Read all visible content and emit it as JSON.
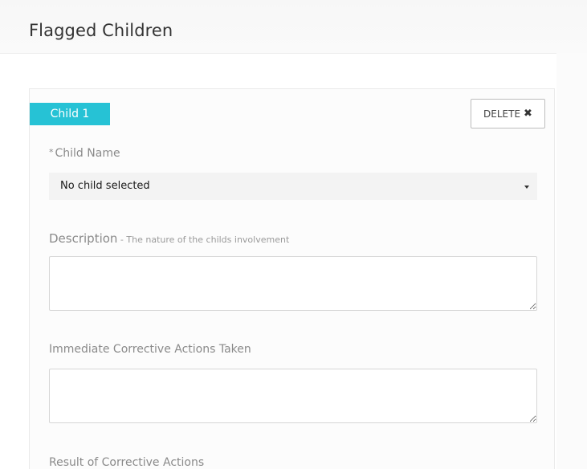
{
  "header": {
    "title": "Flagged Children"
  },
  "card": {
    "tag_label": "Child 1",
    "delete_label": "DELETE",
    "delete_icon": "times-icon",
    "child_name": {
      "required_mark": "*",
      "label": "Child Name",
      "selected_value": "No child selected"
    },
    "description": {
      "label": "Description",
      "hint": " - The nature of the childs involvement",
      "value": ""
    },
    "immediate_actions": {
      "label": "Immediate Corrective Actions Taken",
      "value": ""
    },
    "result_actions": {
      "label": "Result of Corrective Actions"
    }
  },
  "colors": {
    "accent": "#26c2d5"
  }
}
